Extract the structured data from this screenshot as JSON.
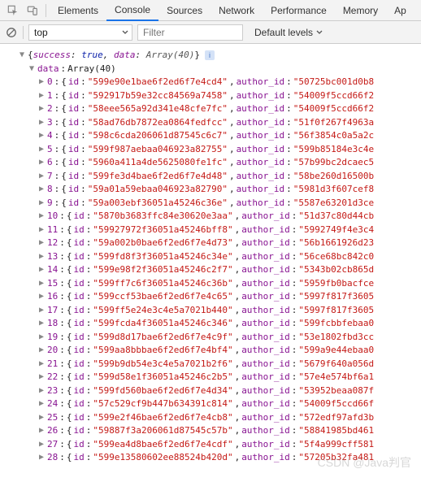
{
  "tabs": {
    "elements": "Elements",
    "console": "Console",
    "sources": "Sources",
    "network": "Network",
    "performance": "Performance",
    "memory": "Memory",
    "app_partial": "Ap"
  },
  "filterbar": {
    "context": "top",
    "filter_placeholder": "Filter",
    "levels": "Default levels"
  },
  "root_preview": {
    "success_key": "success",
    "success_val": "true",
    "data_key": "data",
    "array_label": "Array(40)"
  },
  "data_header": {
    "label": "data",
    "type": "Array(40)"
  },
  "rows": [
    {
      "i": "0",
      "id": "599e90e1bae6f2ed6f7e4cd4",
      "aid": "50725bc001d0b8"
    },
    {
      "i": "1",
      "id": "592917b59e32cc84569a7458",
      "aid": "54009f5ccd66f2"
    },
    {
      "i": "2",
      "id": "58eee565a92d341e48cfe7fc",
      "aid": "54009f5ccd66f2"
    },
    {
      "i": "3",
      "id": "58ad76db7872ea0864fedfcc",
      "aid": "51f0f267f4963a"
    },
    {
      "i": "4",
      "id": "598c6cda206061d87545c6c7",
      "aid": "56f3854c0a5a2c"
    },
    {
      "i": "5",
      "id": "599f987aebaa046923a82755",
      "aid": "599b85184e3c4e"
    },
    {
      "i": "6",
      "id": "5960a411a4de5625080fe1fc",
      "aid": "57b99bc2dcaec5"
    },
    {
      "i": "7",
      "id": "599fe3d4bae6f2ed6f7e4d48",
      "aid": "58be260d16500b"
    },
    {
      "i": "8",
      "id": "59a01a59ebaa046923a82790",
      "aid": "5981d3f607cef8"
    },
    {
      "i": "9",
      "id": "59a003ebf36051a45246c36e",
      "aid": "5587e63201d3ce"
    },
    {
      "i": "10",
      "id": "5870b3683ffc84e30620e3aa",
      "aid": "51d37c80d44cb"
    },
    {
      "i": "11",
      "id": "59927972f36051a45246bff8",
      "aid": "5992749f4e3c4"
    },
    {
      "i": "12",
      "id": "59a002b0bae6f2ed6f7e4d73",
      "aid": "56b1661926d23"
    },
    {
      "i": "13",
      "id": "599fd8f3f36051a45246c34e",
      "aid": "56ce68bc842c0"
    },
    {
      "i": "14",
      "id": "599e98f2f36051a45246c2f7",
      "aid": "5343b02cb865d"
    },
    {
      "i": "15",
      "id": "599ff7c6f36051a45246c36b",
      "aid": "5959fb0bacfce"
    },
    {
      "i": "16",
      "id": "599ccf53bae6f2ed6f7e4c65",
      "aid": "5997f817f3605"
    },
    {
      "i": "17",
      "id": "599ff5e24e3c4e5a7021b440",
      "aid": "5997f817f3605"
    },
    {
      "i": "18",
      "id": "599fcda4f36051a45246c346",
      "aid": "599fcbbfebaa0"
    },
    {
      "i": "19",
      "id": "599d8d17bae6f2ed6f7e4c9f",
      "aid": "53e1802fbd3cc"
    },
    {
      "i": "20",
      "id": "599aa8bbbae6f2ed6f7e4bf4",
      "aid": "599a9e44ebaa0"
    },
    {
      "i": "21",
      "id": "599b9db54e3c4e5a7021b2f6",
      "aid": "5679f640a056d"
    },
    {
      "i": "22",
      "id": "599d58e1f36051a45246c2b5",
      "aid": "57e4e574bf6a1"
    },
    {
      "i": "23",
      "id": "599fd560bae6f2ed6f7e4d34",
      "aid": "53952beaa087f"
    },
    {
      "i": "24",
      "id": "57c529cf9b447b634391c814",
      "aid": "54009f5ccd66f"
    },
    {
      "i": "25",
      "id": "599e2f46bae6f2ed6f7e4cb8",
      "aid": "572edf97afd3b"
    },
    {
      "i": "26",
      "id": "59887f3a206061d87545c57b",
      "aid": "58841985bd461"
    },
    {
      "i": "27",
      "id": "599ea4d8bae6f2ed6f7e4cdf",
      "aid": "5f4a999cff581"
    },
    {
      "i": "28",
      "id": "599e13580602ee88524b420d",
      "aid": "57205b32fa481"
    }
  ],
  "labels": {
    "id": "id",
    "author_id": "author_id"
  },
  "watermark": "CSDN @Java判官"
}
